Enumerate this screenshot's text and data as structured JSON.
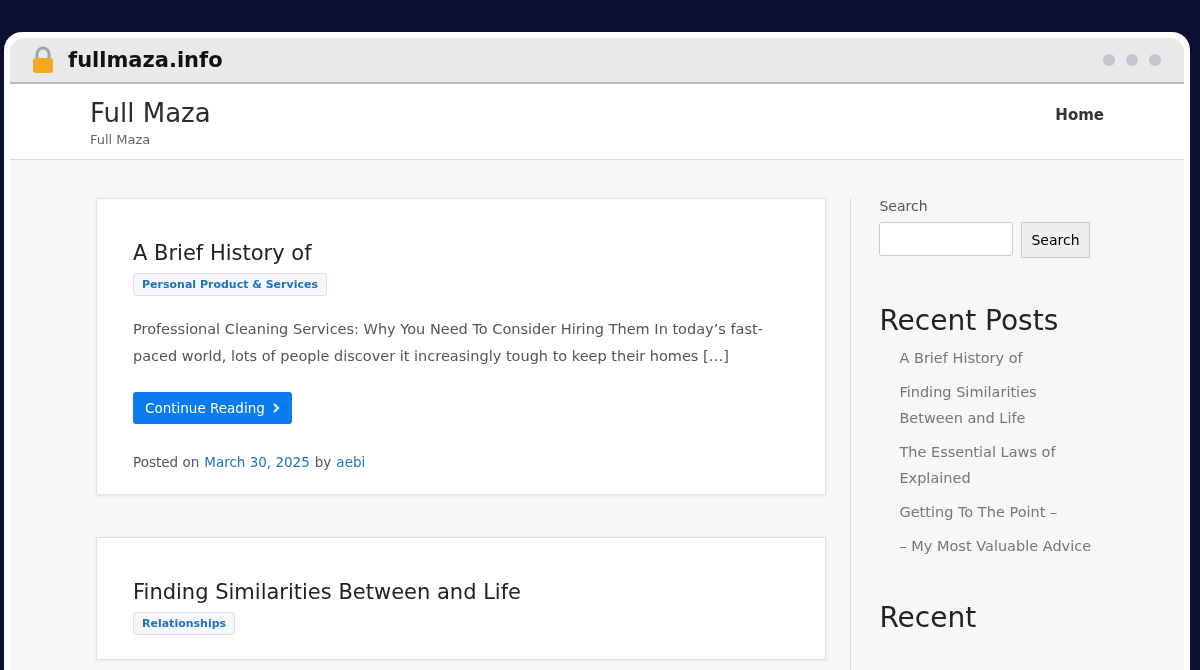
{
  "browser": {
    "url": "fullmaza.info"
  },
  "site": {
    "title": "Full Maza",
    "tagline": "Full Maza",
    "nav": [
      {
        "label": "Home"
      }
    ]
  },
  "posts": [
    {
      "title": "A Brief History of",
      "category": "Personal Product & Services",
      "excerpt": "Professional Cleaning Services: Why You Need To Consider Hiring Them In today’s fast-paced world, lots of people discover it increasingly tough to keep their homes […]",
      "button": "Continue Reading",
      "posted_on": "Posted on",
      "date": "March 30, 2025",
      "by": "by",
      "author": "aebi"
    },
    {
      "title": "Finding Similarities Between and Life",
      "category": "Relationships"
    }
  ],
  "sidebar": {
    "search_label": "Search",
    "search_button": "Search",
    "recent_posts_title": "Recent Posts",
    "recent_posts": [
      "A Brief History of",
      "Finding Similarities Between and Life",
      "The Essential Laws of Explained",
      "Getting To The Point –",
      "– My Most Valuable Advice"
    ],
    "next_widget_title": "Recent"
  }
}
